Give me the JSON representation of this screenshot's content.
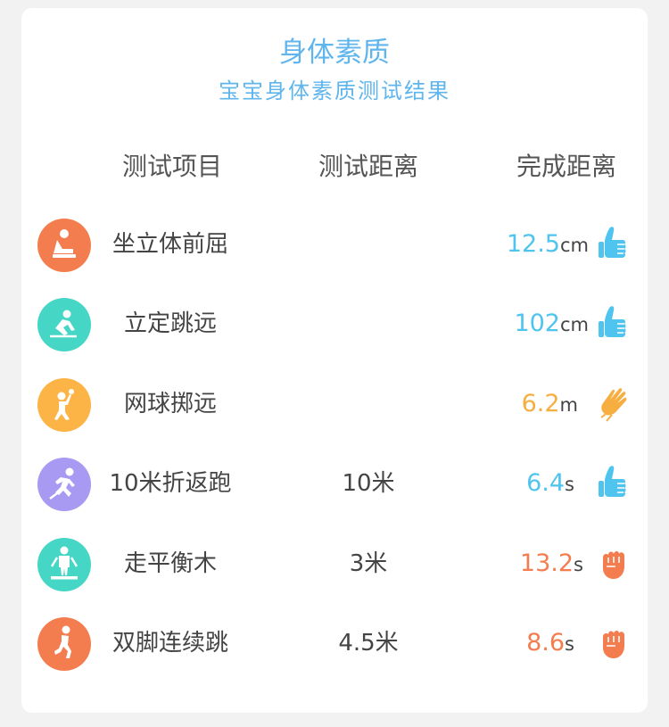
{
  "title": "身体素质",
  "subtitle": "宝宝身体素质测试结果",
  "headers": {
    "item": "测试项目",
    "test_distance": "测试距离",
    "done_distance": "完成距离"
  },
  "colors": {
    "title_blue": "#5fb5ec",
    "orange": "#f47d4f",
    "teal": "#45d6c5",
    "yellow": "#fdb446",
    "purple": "#a89af2",
    "blue_value": "#4ec4ee",
    "orange_value": "#f47d4f",
    "yellow_value": "#f6ae40"
  },
  "rows": [
    {
      "name": "坐立体前屈",
      "test_distance": "",
      "value": "12.5",
      "unit": "cm",
      "icon": "sit-and-reach-icon",
      "hand": "thumbs-up-icon"
    },
    {
      "name": "立定跳远",
      "test_distance": "",
      "value": "102",
      "unit": "cm",
      "icon": "long-jump-icon",
      "hand": "thumbs-up-icon"
    },
    {
      "name": "网球掷远",
      "test_distance": "",
      "value": "6.2",
      "unit": "m",
      "icon": "ball-throw-icon",
      "hand": "clapping-hands-icon"
    },
    {
      "name": "10米折返跑",
      "test_distance": "10米",
      "value": "6.4",
      "unit": "s",
      "icon": "shuttle-run-icon",
      "hand": "thumbs-up-icon"
    },
    {
      "name": "走平衡木",
      "test_distance": "3米",
      "value": "13.2",
      "unit": "s",
      "icon": "balance-beam-icon",
      "hand": "raised-fist-icon"
    },
    {
      "name": "双脚连续跳",
      "test_distance": "4.5米",
      "value": "8.6",
      "unit": "s",
      "icon": "continuous-jump-icon",
      "hand": "raised-fist-icon"
    }
  ]
}
